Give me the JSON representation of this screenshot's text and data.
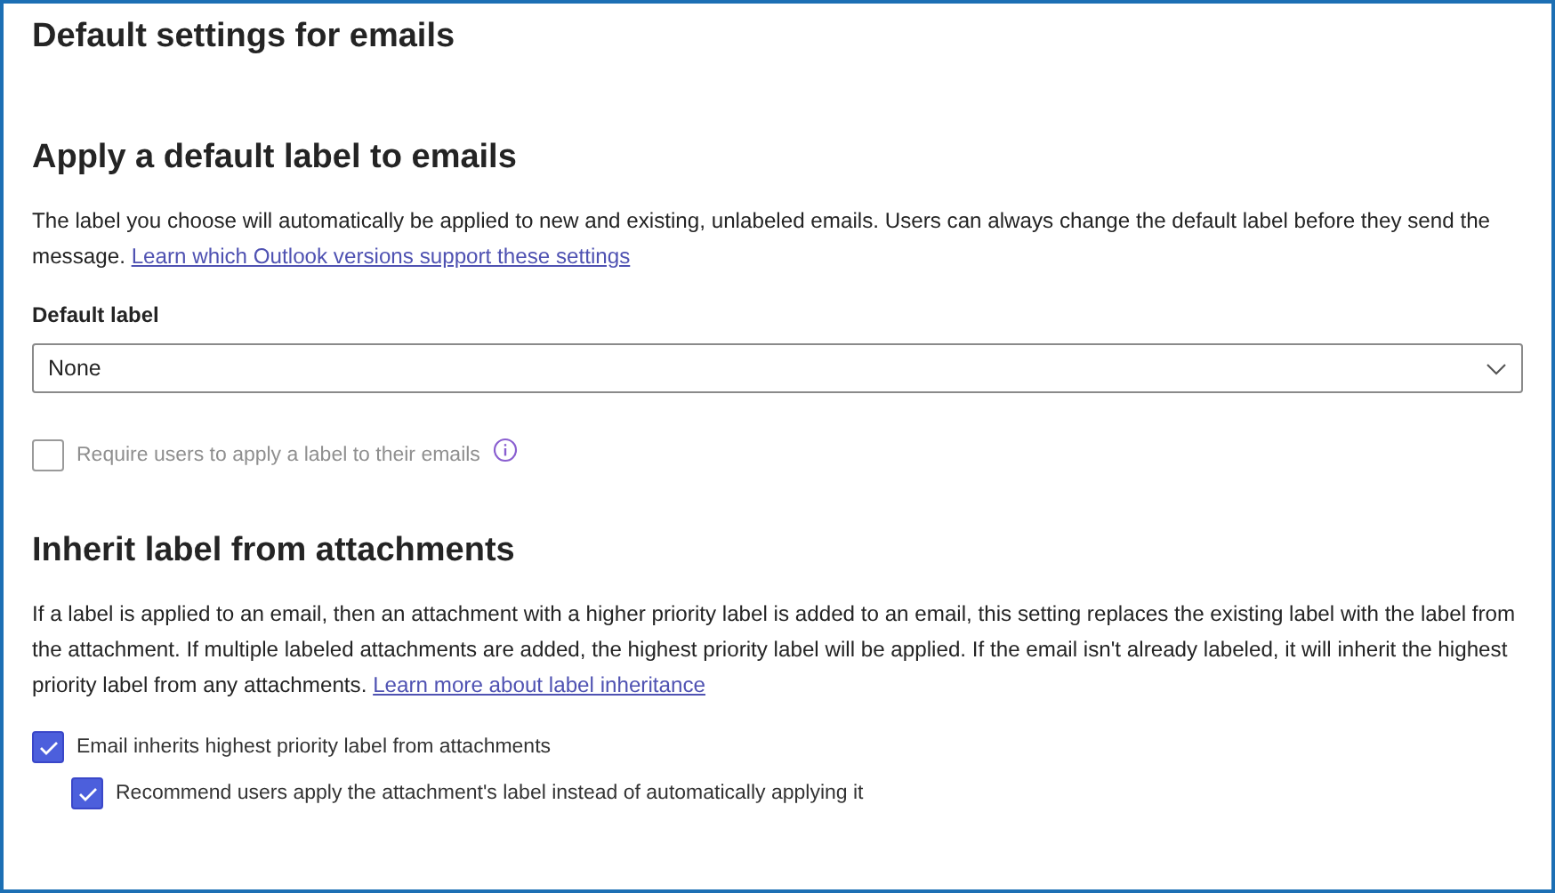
{
  "page_title": "Default settings for emails",
  "sections": [
    {
      "heading": "Apply a default label to emails",
      "description": "The label you choose will automatically be applied to new and existing, unlabeled emails. Users can always change the default label before they send the message.",
      "link": "Learn which Outlook versions support these settings",
      "dropdown": {
        "label": "Default label",
        "value": "None"
      },
      "checkboxes": [
        {
          "label": "Require users to apply a label to their emails",
          "checked": false,
          "disabled": true,
          "info": true
        }
      ]
    },
    {
      "heading": "Inherit label from attachments",
      "description": "If a label is applied to an email, then an attachment with a higher priority label is added to an email, this setting replaces the existing label with the label from the attachment. If multiple labeled attachments are added, the highest priority label will be applied. If the email isn't already labeled, it will inherit the highest priority label from any attachments.",
      "link": "Learn more about label inheritance",
      "checkboxes": [
        {
          "label": "Email inherits highest priority label from attachments",
          "checked": true,
          "children": [
            {
              "label": "Recommend users apply the attachment's label instead of automatically applying it",
              "checked": true
            }
          ]
        }
      ]
    }
  ]
}
